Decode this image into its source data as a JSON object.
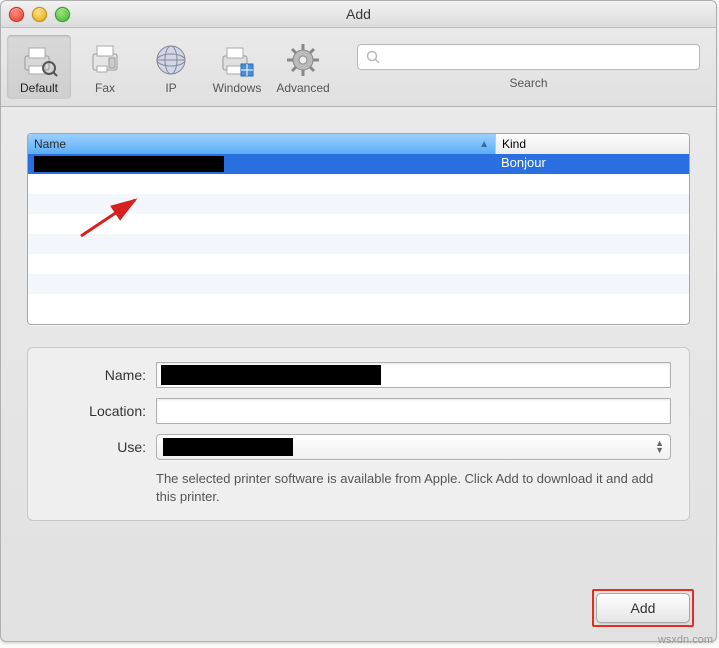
{
  "window": {
    "title": "Add"
  },
  "toolbar": {
    "items": [
      {
        "label": "Default",
        "icon": "printer-search-icon",
        "selected": true
      },
      {
        "label": "Fax",
        "icon": "fax-icon"
      },
      {
        "label": "IP",
        "icon": "globe-icon"
      },
      {
        "label": "Windows",
        "icon": "windows-printer-icon"
      },
      {
        "label": "Advanced",
        "icon": "gear-icon"
      }
    ],
    "search": {
      "placeholder": "",
      "label": "Search"
    }
  },
  "list": {
    "columns": {
      "name": "Name",
      "kind": "Kind"
    },
    "rows": [
      {
        "name": "",
        "kind": "Bonjour",
        "selected": true
      }
    ]
  },
  "form": {
    "name": {
      "label": "Name:",
      "value": ""
    },
    "location": {
      "label": "Location:",
      "value": ""
    },
    "use": {
      "label": "Use:",
      "value": ""
    },
    "hint": "The selected printer software is available from Apple. Click Add to download it and add this printer."
  },
  "footer": {
    "add_label": "Add"
  },
  "watermark": "wsxdn.com"
}
